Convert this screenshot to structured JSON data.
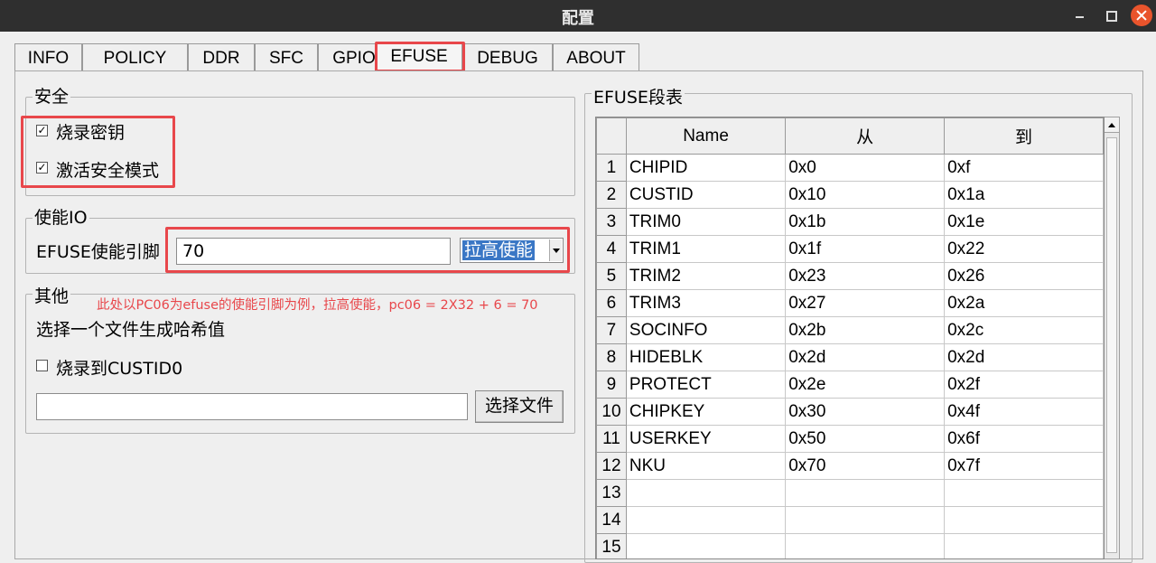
{
  "window": {
    "title": "配置",
    "controls": [
      "minimize-icon",
      "maximize-icon",
      "close-icon"
    ]
  },
  "tabs": [
    {
      "label": "INFO"
    },
    {
      "label": "POLICY"
    },
    {
      "label": "DDR"
    },
    {
      "label": "SFC"
    },
    {
      "label": "GPIO"
    },
    {
      "label": "EFUSE",
      "active": true
    },
    {
      "label": "DEBUG"
    },
    {
      "label": "ABOUT"
    }
  ],
  "security": {
    "title": "安全",
    "burn_key": {
      "label": "烧录密钥",
      "checked": true
    },
    "secure_mode": {
      "label": "激活安全模式",
      "checked": true
    }
  },
  "enable_io": {
    "title": "使能IO",
    "pin_label": "EFUSE使能引脚",
    "pin_value": "70",
    "mode_selected": "拉高使能"
  },
  "other": {
    "title": "其他",
    "hash_label": "选择一个文件生成哈希值",
    "burn_custid": {
      "label": "烧录到CUSTID0",
      "checked": false
    },
    "file_path": "",
    "choose_button": "选择文件"
  },
  "annotation": "此处以PC06为efuse的使能引脚为例，拉高使能，pc06 = 2X32 + 6 = 70",
  "efuse_table": {
    "title": "EFUSE段表",
    "columns": [
      "Name",
      "从",
      "到"
    ],
    "rows": [
      {
        "n": "1",
        "name": "CHIPID",
        "from": "0x0",
        "to": "0xf"
      },
      {
        "n": "2",
        "name": "CUSTID",
        "from": "0x10",
        "to": "0x1a"
      },
      {
        "n": "3",
        "name": "TRIM0",
        "from": "0x1b",
        "to": "0x1e"
      },
      {
        "n": "4",
        "name": "TRIM1",
        "from": "0x1f",
        "to": "0x22"
      },
      {
        "n": "5",
        "name": "TRIM2",
        "from": "0x23",
        "to": "0x26"
      },
      {
        "n": "6",
        "name": "TRIM3",
        "from": "0x27",
        "to": "0x2a"
      },
      {
        "n": "7",
        "name": "SOCINFO",
        "from": "0x2b",
        "to": "0x2c"
      },
      {
        "n": "8",
        "name": "HIDEBLK",
        "from": "0x2d",
        "to": "0x2d"
      },
      {
        "n": "9",
        "name": "PROTECT",
        "from": "0x2e",
        "to": "0x2f"
      },
      {
        "n": "10",
        "name": "CHIPKEY",
        "from": "0x30",
        "to": "0x4f"
      },
      {
        "n": "11",
        "name": "USERKEY",
        "from": "0x50",
        "to": "0x6f"
      },
      {
        "n": "12",
        "name": "NKU",
        "from": "0x70",
        "to": "0x7f"
      },
      {
        "n": "13",
        "name": "",
        "from": "",
        "to": ""
      },
      {
        "n": "14",
        "name": "",
        "from": "",
        "to": ""
      },
      {
        "n": "15",
        "name": "",
        "from": "",
        "to": ""
      }
    ]
  },
  "colors": {
    "highlight_box": "#e8474b",
    "selection": "#3a77c5",
    "titlebar": "#2f2f2f",
    "close_button": "#e9542c"
  }
}
